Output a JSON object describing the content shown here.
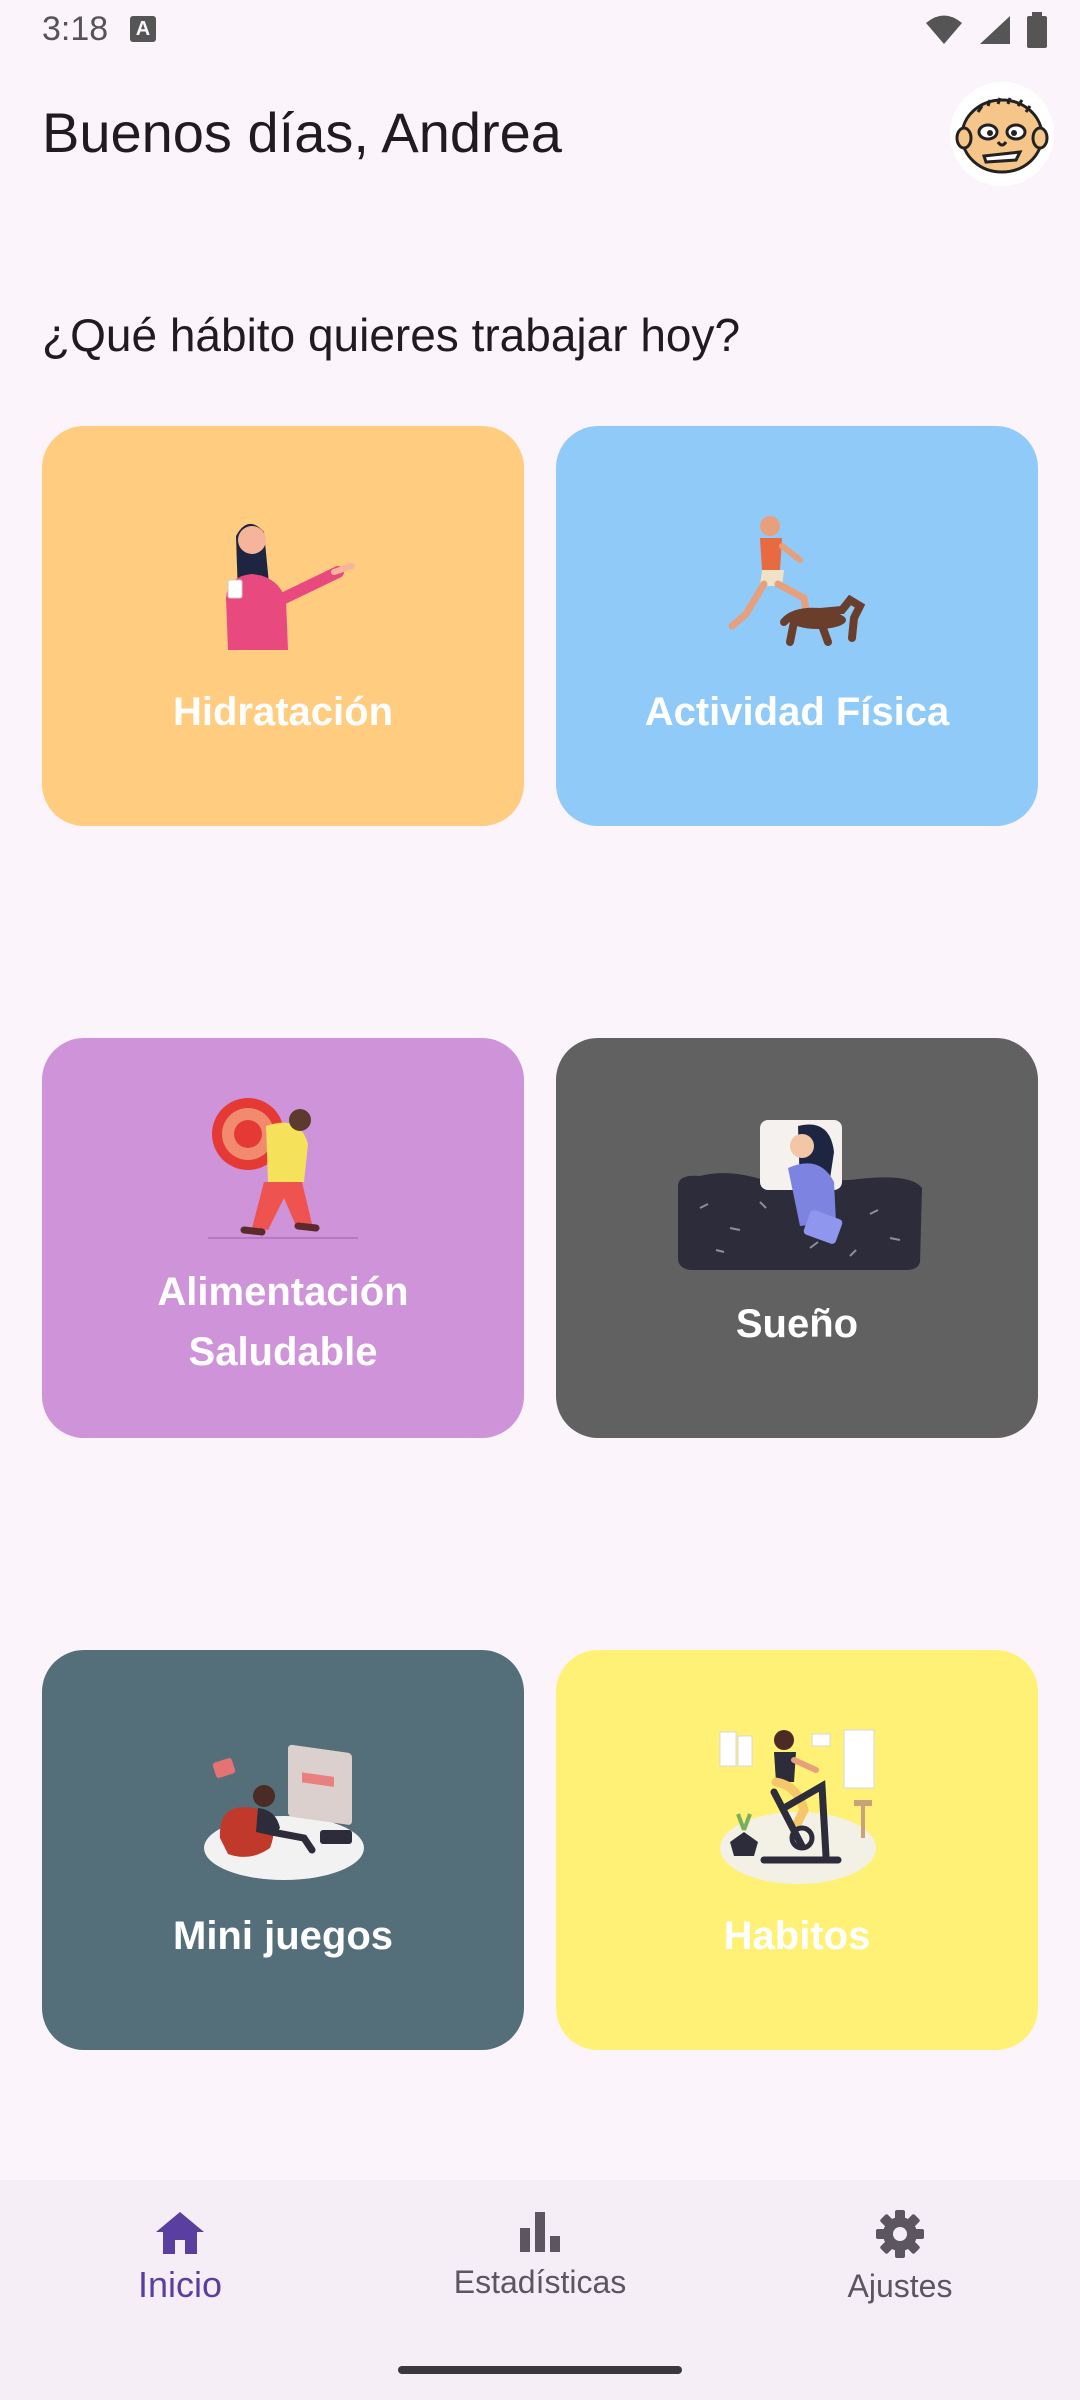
{
  "status_bar": {
    "time": "3:18",
    "notification_icon_letter": "A"
  },
  "header": {
    "greeting": "Buenos días, Andrea"
  },
  "prompt": "¿Qué hábito quieres trabajar hoy?",
  "cards": [
    {
      "label": "Hidratación",
      "color": "#FFCC80",
      "icon": "woman-drinking-water-illustration"
    },
    {
      "label": "Actividad Física",
      "color": "#90CAF9",
      "icon": "man-running-with-dog-illustration"
    },
    {
      "label_line1": "Alimentación",
      "label_line2": "Saludable",
      "color": "#CE93D8",
      "icon": "person-carrying-tomato-illustration"
    },
    {
      "label": "Sueño",
      "color": "#616161",
      "icon": "woman-sleeping-illustration"
    },
    {
      "label": "Mini juegos",
      "color": "#546E7A",
      "icon": "person-playing-videogames-illustration"
    },
    {
      "label": "Habitos",
      "color": "#FFF176",
      "icon": "woman-exercise-bike-illustration"
    }
  ],
  "bottom_nav": [
    {
      "label": "Inicio",
      "icon": "home-icon",
      "active": true
    },
    {
      "label": "Estadísticas",
      "icon": "bar-chart-icon",
      "active": false
    },
    {
      "label": "Ajustes",
      "icon": "gear-icon",
      "active": false
    }
  ],
  "colors": {
    "background": "#FCF4FB",
    "accent": "#5B3FA0"
  }
}
